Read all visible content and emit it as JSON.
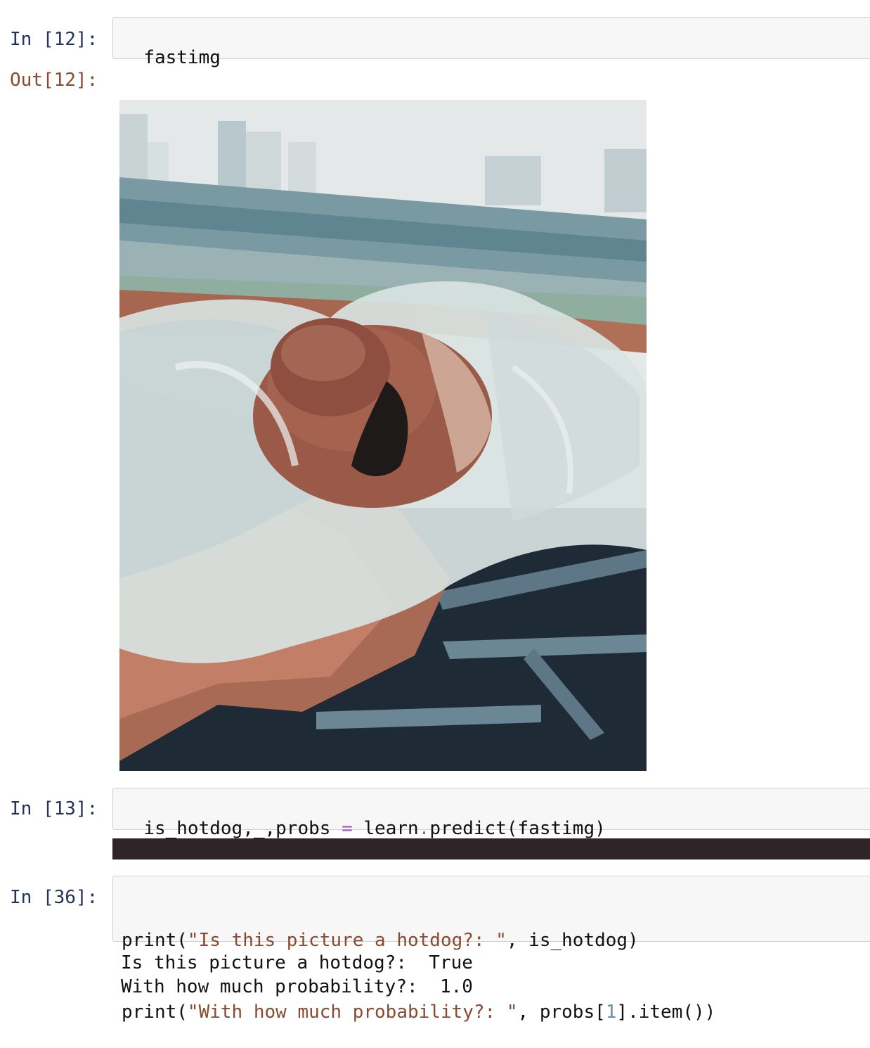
{
  "cells": [
    {
      "prompt": "In [12]:",
      "source_lines": [
        "fastimg"
      ]
    },
    {
      "prompt": "Out[12]:",
      "output_kind": "image",
      "image_description_icon": "hotdog-photo-icon"
    },
    {
      "prompt": "In [13]:",
      "source_parts": {
        "lhs": "is_hotdog,_,probs ",
        "eq": "=",
        "rhs_a": " learn",
        "dot": ".",
        "rhs_b": "predict(fastimg)"
      }
    },
    {
      "prompt": "In [36]:",
      "line1": {
        "fn": "print(",
        "str": "\"Is this picture a hotdog?: \"",
        "rest": ", is_hotdog)"
      },
      "line2": {
        "fn": "print(",
        "str": "\"With how much probability?: \"",
        "rest_a": ", probs[",
        "num": "1",
        "rest_b": "].item())"
      },
      "stdout": [
        "Is this picture a hotdog?:  True",
        "With how much probability?:  1.0"
      ]
    }
  ],
  "colors": {
    "prompt_in": "#26325a",
    "prompt_out": "#8a4a2f",
    "string": "#8a4a2f",
    "stderr_bar": "#2f2427"
  }
}
